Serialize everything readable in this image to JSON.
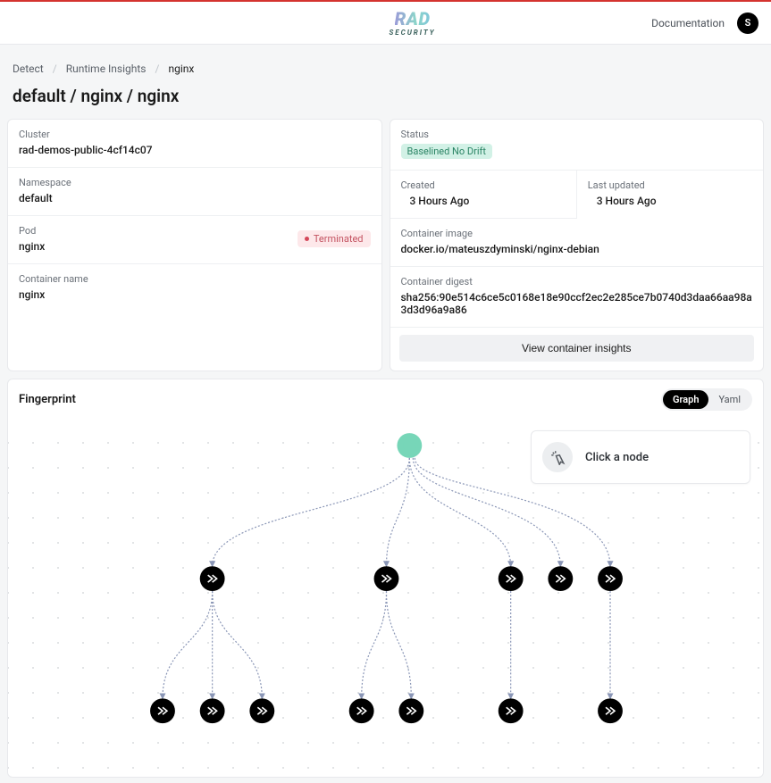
{
  "topbar": {
    "doc_link": "Documentation",
    "avatar_initial": "S",
    "logo_top": "RAD",
    "logo_bottom": "SECURITY"
  },
  "breadcrumbs": {
    "b1": "Detect",
    "b2": "Runtime Insights",
    "b3": "nginx"
  },
  "page_title": "default / nginx / nginx",
  "left": {
    "cluster_label": "Cluster",
    "cluster_value": "rad-demos-public-4cf14c07",
    "namespace_label": "Namespace",
    "namespace_value": "default",
    "pod_label": "Pod",
    "pod_value": "nginx",
    "pod_status": "Terminated",
    "cname_label": "Container name",
    "cname_value": "nginx"
  },
  "right": {
    "status_label": "Status",
    "status_value": "Baselined No Drift",
    "created_label": "Created",
    "created_value": "3 Hours Ago",
    "updated_label": "Last updated",
    "updated_value": "3 Hours Ago",
    "image_label": "Container image",
    "image_value": "docker.io/mateuszdyminski/nginx-debian",
    "digest_label": "Container digest",
    "digest_value": "sha256:90e514c6ce5c0168e18e90ccf2ec2e285ce7b0740d3daa66aa98a3d3d96a9a86",
    "insights_btn": "View container insights"
  },
  "fingerprint": {
    "title": "Fingerprint",
    "toggle_graph": "Graph",
    "toggle_yaml": "Yaml",
    "click_note": "Click a node"
  }
}
